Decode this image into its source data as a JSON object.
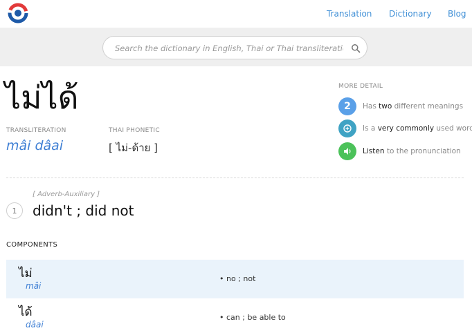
{
  "header": {
    "logo": "site-logo",
    "nav": [
      "Translation",
      "Dictionary",
      "Blog"
    ]
  },
  "search": {
    "placeholder": "Search the dictionary in English, Thai or Thai transliteration",
    "value": ""
  },
  "entry": {
    "headword": "ไม่ได้",
    "transliteration_label": "TRANSLITERATION",
    "transliteration": "mâi dâai",
    "phonetic_label": "THAI PHONETIC",
    "phonetic": "[ ไม่-ด้าย ]"
  },
  "more_detail": {
    "title": "MORE DETAIL",
    "items": [
      {
        "badge": "2",
        "pre": "Has ",
        "hl": "two",
        "post": " different meanings",
        "color": "#5aa0e8"
      },
      {
        "badge": "",
        "pre": "Is a ",
        "hl": "very commonly",
        "post": " used word",
        "color": "#3fa3c4"
      },
      {
        "badge": "",
        "pre": "",
        "hl": "Listen",
        "post": " to the pronunciation",
        "color": "#4cc25a"
      }
    ]
  },
  "meanings": [
    {
      "number": "1",
      "pos": "[ Adverb-Auxiliary ]",
      "text": "didn't ; did not"
    }
  ],
  "components": {
    "title": "COMPONENTS",
    "rows": [
      {
        "thai": "ไม่",
        "roman": "mâi",
        "definition": "• no ; not"
      },
      {
        "thai": "ได้",
        "roman": "dâai",
        "definition": "• can ; be able to"
      }
    ]
  }
}
